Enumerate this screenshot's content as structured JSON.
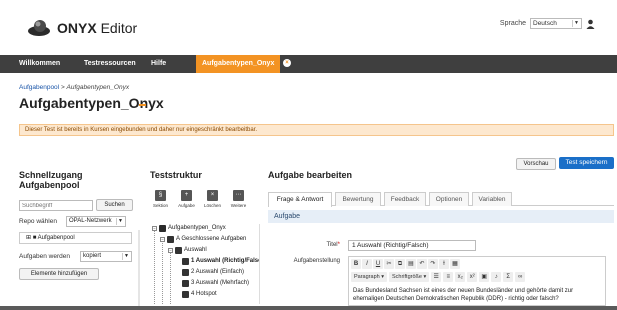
{
  "header": {
    "logo_bold": "ONYX",
    "logo_light": "Editor",
    "language_label": "Sprache",
    "language_value": "Deutsch"
  },
  "nav": {
    "items": [
      "Willkommen",
      "Testressourcen",
      "Hilfe"
    ],
    "active_tab": "Aufgabentypen_Onyx"
  },
  "breadcrumb": {
    "link": "Aufgabenpool",
    "separator": ">",
    "current": "Aufgabentypen_Onyx"
  },
  "page_title": "Aufgabentypen_Onyx",
  "notice": "Dieser Test ist bereits in Kursen eingebunden und daher nur eingeschränkt bearbeitbar.",
  "actions": {
    "preview": "Vorschau",
    "save": "Test speichern"
  },
  "quick_access": {
    "title_line1": "Schnellzugang",
    "title_line2": "Aufgabenpool",
    "search_placeholder": "Suchbegriff",
    "search_button": "Suchen",
    "repo_label": "Repo wählen",
    "repo_value": "OPAL-Netzwerk",
    "pool_item": "Aufgabenpool",
    "add_label": "Aufgaben werden",
    "add_value": "kopiert",
    "add_button": "Elemente hinzufügen"
  },
  "test_structure": {
    "title": "Teststruktur",
    "tools": [
      "Sektion",
      "Aufgabe",
      "Löschen",
      "Weitere"
    ],
    "tree": [
      "Aufgabentypen_Onyx",
      "A Geschlossene Aufgaben",
      "Auswahl",
      "1 Auswahl (Richtig/Falsch)",
      "2 Auswahl (Einfach)",
      "3 Auswahl (Mehrfach)",
      "4 Hotspot"
    ]
  },
  "edit_task": {
    "title": "Aufgabe bearbeiten",
    "tabs": [
      "Frage & Antwort",
      "Bewertung",
      "Feedback",
      "Optionen",
      "Variablen"
    ],
    "section": "Aufgabe",
    "title_label": "Titel",
    "title_value": "1 Auswahl (Richtig/Falsch)",
    "prompt_label": "Aufgabenstellung",
    "format_paragraph": "Paragraph",
    "format_size": "Schriftgröße",
    "prompt_text": "Das Bundesland Sachsen ist eines der neuen Bundesländer und gehörte damit zur ehemaligen Deutschen Demokratischen Republik (DDR) - richtig oder falsch?"
  }
}
